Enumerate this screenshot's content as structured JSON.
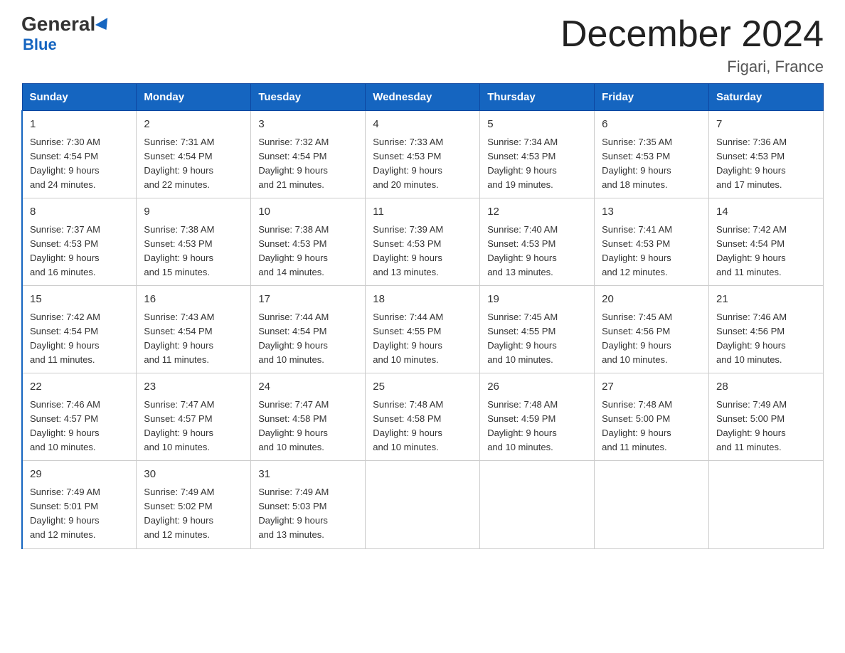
{
  "header": {
    "title": "December 2024",
    "subtitle": "Figari, France",
    "logo_top": "General",
    "logo_bottom": "Blue"
  },
  "days_of_week": [
    "Sunday",
    "Monday",
    "Tuesday",
    "Wednesday",
    "Thursday",
    "Friday",
    "Saturday"
  ],
  "weeks": [
    [
      {
        "day": "1",
        "sunrise": "7:30 AM",
        "sunset": "4:54 PM",
        "daylight": "9 hours and 24 minutes."
      },
      {
        "day": "2",
        "sunrise": "7:31 AM",
        "sunset": "4:54 PM",
        "daylight": "9 hours and 22 minutes."
      },
      {
        "day": "3",
        "sunrise": "7:32 AM",
        "sunset": "4:54 PM",
        "daylight": "9 hours and 21 minutes."
      },
      {
        "day": "4",
        "sunrise": "7:33 AM",
        "sunset": "4:53 PM",
        "daylight": "9 hours and 20 minutes."
      },
      {
        "day": "5",
        "sunrise": "7:34 AM",
        "sunset": "4:53 PM",
        "daylight": "9 hours and 19 minutes."
      },
      {
        "day": "6",
        "sunrise": "7:35 AM",
        "sunset": "4:53 PM",
        "daylight": "9 hours and 18 minutes."
      },
      {
        "day": "7",
        "sunrise": "7:36 AM",
        "sunset": "4:53 PM",
        "daylight": "9 hours and 17 minutes."
      }
    ],
    [
      {
        "day": "8",
        "sunrise": "7:37 AM",
        "sunset": "4:53 PM",
        "daylight": "9 hours and 16 minutes."
      },
      {
        "day": "9",
        "sunrise": "7:38 AM",
        "sunset": "4:53 PM",
        "daylight": "9 hours and 15 minutes."
      },
      {
        "day": "10",
        "sunrise": "7:38 AM",
        "sunset": "4:53 PM",
        "daylight": "9 hours and 14 minutes."
      },
      {
        "day": "11",
        "sunrise": "7:39 AM",
        "sunset": "4:53 PM",
        "daylight": "9 hours and 13 minutes."
      },
      {
        "day": "12",
        "sunrise": "7:40 AM",
        "sunset": "4:53 PM",
        "daylight": "9 hours and 13 minutes."
      },
      {
        "day": "13",
        "sunrise": "7:41 AM",
        "sunset": "4:53 PM",
        "daylight": "9 hours and 12 minutes."
      },
      {
        "day": "14",
        "sunrise": "7:42 AM",
        "sunset": "4:54 PM",
        "daylight": "9 hours and 11 minutes."
      }
    ],
    [
      {
        "day": "15",
        "sunrise": "7:42 AM",
        "sunset": "4:54 PM",
        "daylight": "9 hours and 11 minutes."
      },
      {
        "day": "16",
        "sunrise": "7:43 AM",
        "sunset": "4:54 PM",
        "daylight": "9 hours and 11 minutes."
      },
      {
        "day": "17",
        "sunrise": "7:44 AM",
        "sunset": "4:54 PM",
        "daylight": "9 hours and 10 minutes."
      },
      {
        "day": "18",
        "sunrise": "7:44 AM",
        "sunset": "4:55 PM",
        "daylight": "9 hours and 10 minutes."
      },
      {
        "day": "19",
        "sunrise": "7:45 AM",
        "sunset": "4:55 PM",
        "daylight": "9 hours and 10 minutes."
      },
      {
        "day": "20",
        "sunrise": "7:45 AM",
        "sunset": "4:56 PM",
        "daylight": "9 hours and 10 minutes."
      },
      {
        "day": "21",
        "sunrise": "7:46 AM",
        "sunset": "4:56 PM",
        "daylight": "9 hours and 10 minutes."
      }
    ],
    [
      {
        "day": "22",
        "sunrise": "7:46 AM",
        "sunset": "4:57 PM",
        "daylight": "9 hours and 10 minutes."
      },
      {
        "day": "23",
        "sunrise": "7:47 AM",
        "sunset": "4:57 PM",
        "daylight": "9 hours and 10 minutes."
      },
      {
        "day": "24",
        "sunrise": "7:47 AM",
        "sunset": "4:58 PM",
        "daylight": "9 hours and 10 minutes."
      },
      {
        "day": "25",
        "sunrise": "7:48 AM",
        "sunset": "4:58 PM",
        "daylight": "9 hours and 10 minutes."
      },
      {
        "day": "26",
        "sunrise": "7:48 AM",
        "sunset": "4:59 PM",
        "daylight": "9 hours and 10 minutes."
      },
      {
        "day": "27",
        "sunrise": "7:48 AM",
        "sunset": "5:00 PM",
        "daylight": "9 hours and 11 minutes."
      },
      {
        "day": "28",
        "sunrise": "7:49 AM",
        "sunset": "5:00 PM",
        "daylight": "9 hours and 11 minutes."
      }
    ],
    [
      {
        "day": "29",
        "sunrise": "7:49 AM",
        "sunset": "5:01 PM",
        "daylight": "9 hours and 12 minutes."
      },
      {
        "day": "30",
        "sunrise": "7:49 AM",
        "sunset": "5:02 PM",
        "daylight": "9 hours and 12 minutes."
      },
      {
        "day": "31",
        "sunrise": "7:49 AM",
        "sunset": "5:03 PM",
        "daylight": "9 hours and 13 minutes."
      },
      null,
      null,
      null,
      null
    ]
  ],
  "labels": {
    "sunrise_prefix": "Sunrise: ",
    "sunset_prefix": "Sunset: ",
    "daylight_prefix": "Daylight: "
  }
}
